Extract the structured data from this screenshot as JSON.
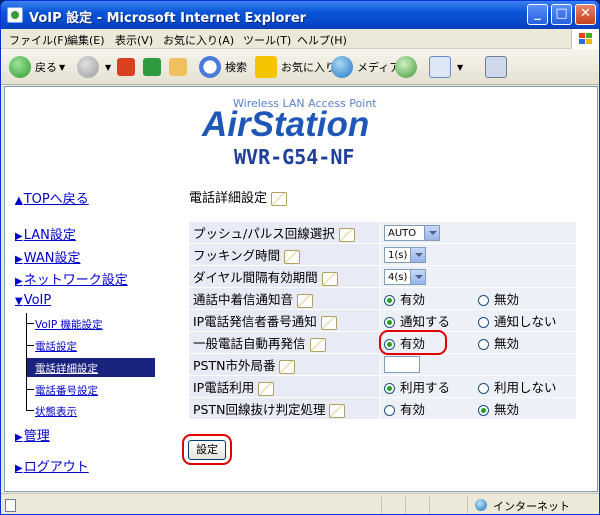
{
  "window": {
    "title": "VoIP 設定 - Microsoft Internet Explorer",
    "min": "_",
    "max": "□",
    "close": "✕"
  },
  "menu": [
    "ファイル(F)",
    "編集(E)",
    "表示(V)",
    "お気に入り(A)",
    "ツール(T)",
    "ヘルプ(H)"
  ],
  "toolbar": {
    "back": "戻る",
    "search": "検索",
    "favorites": "お気に入り",
    "media": "メディア"
  },
  "brand": {
    "tagline": "Wireless LAN Access Point",
    "logo": "AirStation",
    "model": "WVR-G54-NF"
  },
  "nav": {
    "top": "TOPへ戻る",
    "lan": "LAN設定",
    "wan": "WAN設定",
    "network": "ネットワーク設定",
    "voip": "VoIP",
    "admin": "管理",
    "logout": "ログアウト",
    "sub": [
      "VoIP 機能設定",
      "電話設定",
      "電話詳細設定",
      "電話番号設定",
      "状態表示"
    ],
    "selected_index": 2
  },
  "page": {
    "title": "電話詳細設定"
  },
  "settings": {
    "rows": [
      {
        "label": "プッシュ/パルス回線選択",
        "type": "select",
        "value": "AUTO"
      },
      {
        "label": "フッキング時間",
        "type": "select",
        "value": "1(s)"
      },
      {
        "label": "ダイヤル間隔有効期間",
        "type": "select",
        "value": "4(s)"
      },
      {
        "label": "通話中着信通知音",
        "type": "radio",
        "options": [
          "有効",
          "無効"
        ],
        "selected": 0
      },
      {
        "label": "IP電話発信者番号通知",
        "type": "radio",
        "options": [
          "通知する",
          "通知しない"
        ],
        "selected": 0
      },
      {
        "label": "一般電話自動再発信",
        "type": "radio",
        "options": [
          "有効",
          "無効"
        ],
        "selected": 0
      },
      {
        "label": "PSTN市外局番",
        "type": "text",
        "value": ""
      },
      {
        "label": "IP電話利用",
        "type": "radio",
        "options": [
          "利用する",
          "利用しない"
        ],
        "selected": 0
      },
      {
        "label": "PSTN回線抜け判定処理",
        "type": "radio",
        "options": [
          "有効",
          "無効"
        ],
        "selected": 1
      }
    ]
  },
  "buttons": {
    "set": "設定"
  },
  "status": {
    "zone": "インターネット"
  },
  "colors": {
    "title_bar": "#0a55d8",
    "highlight": "#e00000",
    "nav_selected_bg": "#1a237e",
    "link": "#0000cc",
    "table_cell": "#e8eaf6",
    "logo": "#1f57b8"
  }
}
